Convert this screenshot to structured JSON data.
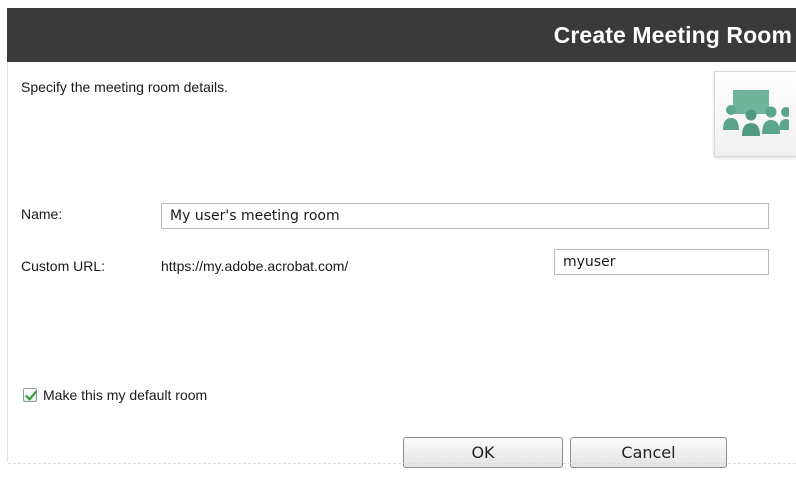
{
  "dialog": {
    "title": "Create Meeting Room",
    "instructions": "Specify the meeting room details."
  },
  "icon": {
    "name": "meeting-room-icon",
    "color": "#5aa58c"
  },
  "form": {
    "name_label": "Name:",
    "name_value": "My user's meeting room",
    "custom_url_label": "Custom URL:",
    "url_prefix": "https://my.adobe.acrobat.com/",
    "custom_url_value": "myuser"
  },
  "default_room": {
    "checked": true,
    "label": "Make this my default room"
  },
  "buttons": {
    "ok": "OK",
    "cancel": "Cancel"
  },
  "colors": {
    "header_background": "#3a3a3a",
    "header_text": "#ffffff",
    "checkmark": "#3a9a3a"
  }
}
